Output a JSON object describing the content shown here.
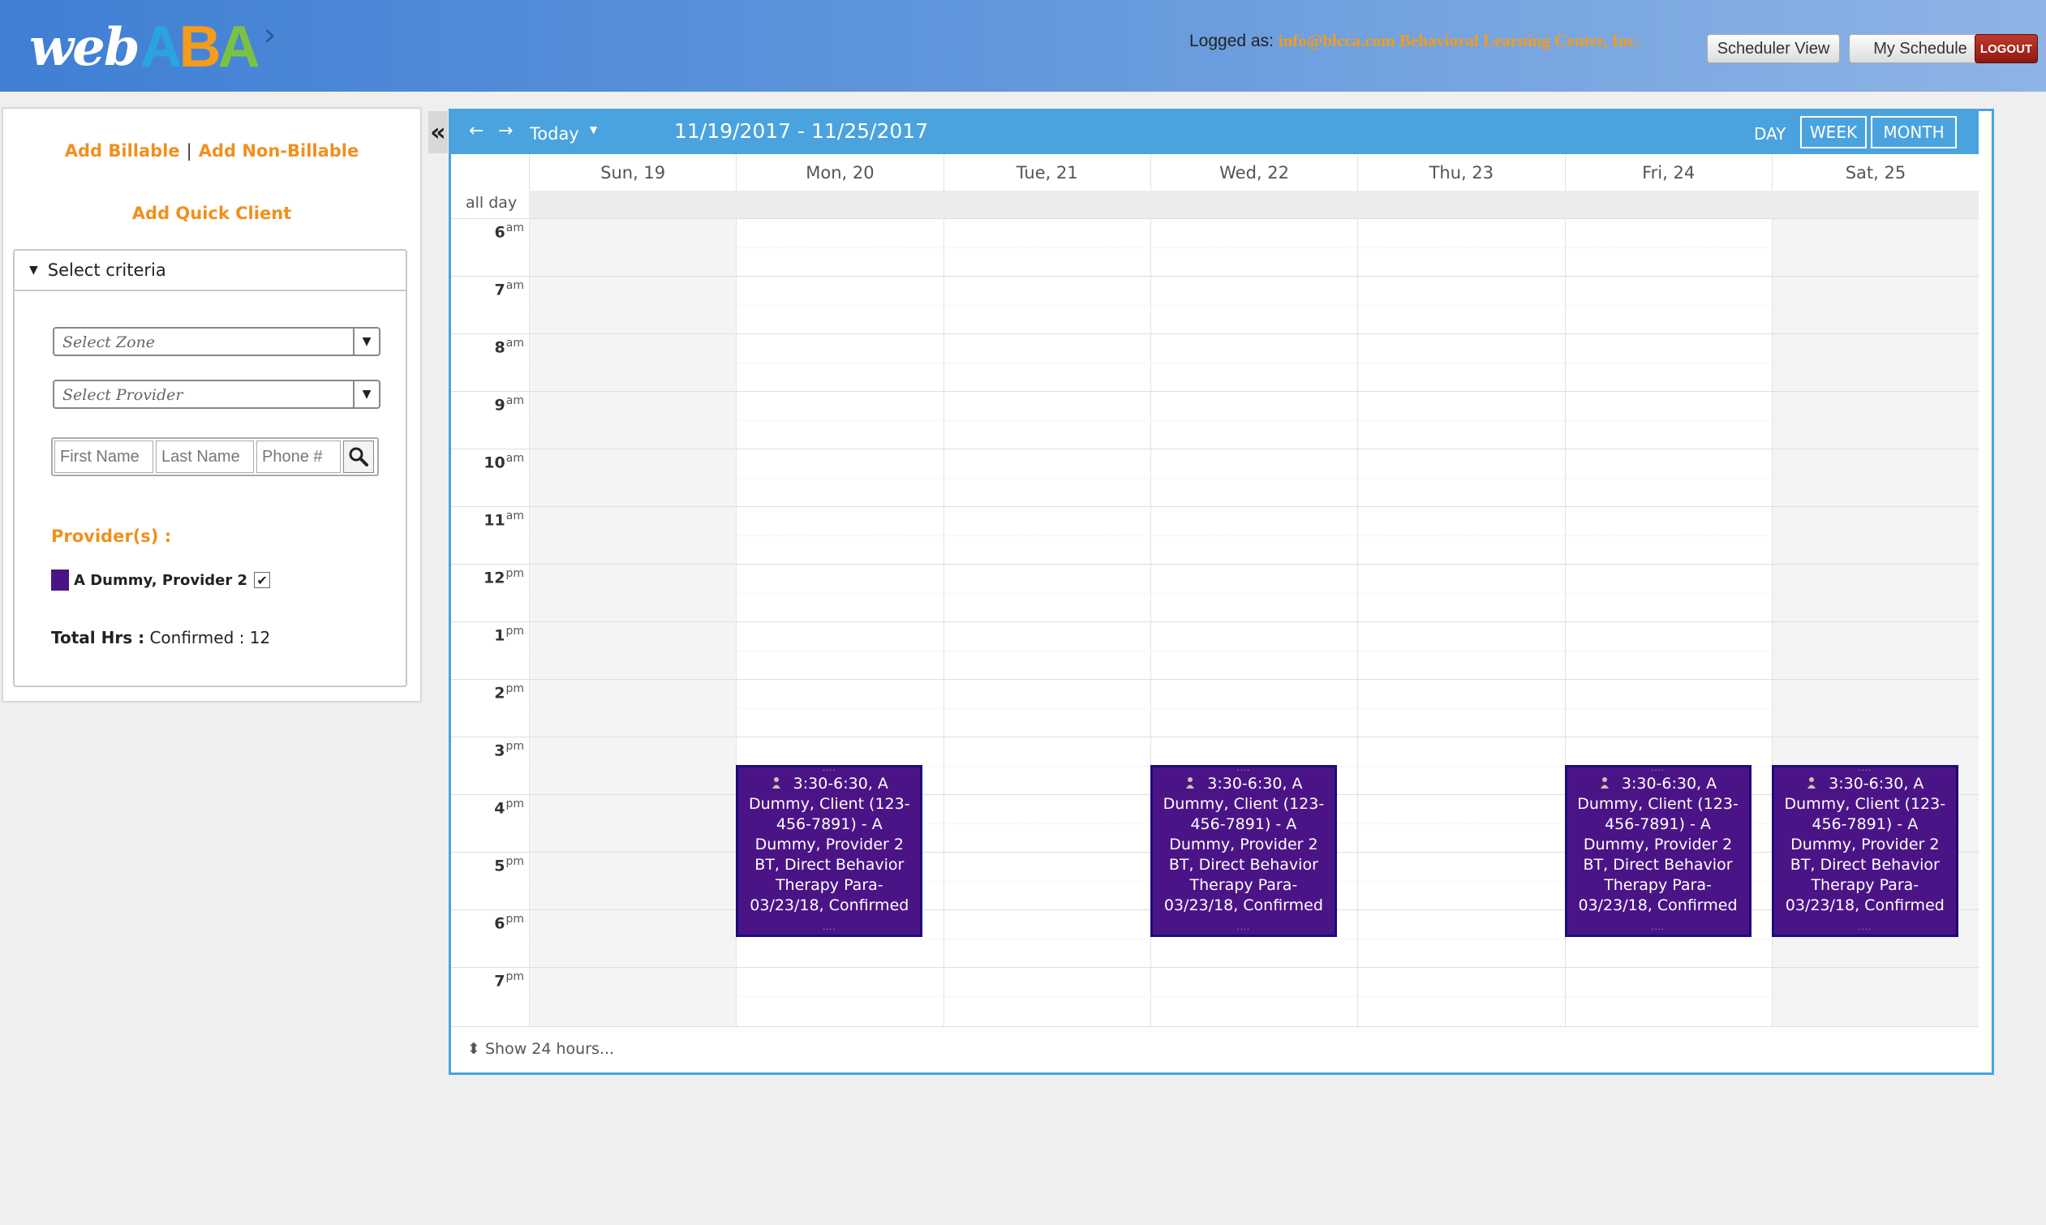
{
  "header": {
    "logo": {
      "web": "web",
      "aba": "ABA"
    },
    "logged_as_label": "Logged as:",
    "logged_as_value": "info@blcca.com Behavioral Learning Center, Inc.",
    "buttons": {
      "scheduler_view": "Scheduler View",
      "my_schedule": "My Schedule",
      "logout": "LOGOUT"
    }
  },
  "sidebar": {
    "add_billable": "Add Billable",
    "separator": "|",
    "add_non_billable": "Add Non-Billable",
    "add_quick_client": "Add Quick Client",
    "criteria_title": "Select criteria",
    "select_zone_placeholder": "Select Zone",
    "select_provider_placeholder": "Select Provider",
    "first_name_placeholder": "First Name",
    "last_name_placeholder": "Last Name",
    "phone_placeholder": "Phone #",
    "providers_label": "Provider(s) :",
    "provider_name": "A Dummy, Provider 2",
    "provider_color": "#4a1487",
    "provider_checked": true,
    "total_hrs_label": "Total Hrs :",
    "total_hrs_value": "Confirmed : 12"
  },
  "calendar": {
    "collapse_icon": "«",
    "toolbar": {
      "prev_icon": "←",
      "next_icon": "→",
      "today": "Today",
      "today_dropdown_icon": "▼",
      "range": "11/19/2017 - 11/25/2017",
      "views": {
        "day": "DAY",
        "week": "WEEK",
        "month": "MONTH"
      }
    },
    "days": [
      "Sun, 19",
      "Mon, 20",
      "Tue, 21",
      "Wed, 22",
      "Thu, 23",
      "Fri, 24",
      "Sat, 25"
    ],
    "all_day_label": "all day",
    "hours": [
      {
        "h": "6",
        "ap": "am"
      },
      {
        "h": "7",
        "ap": "am"
      },
      {
        "h": "8",
        "ap": "am"
      },
      {
        "h": "9",
        "ap": "am"
      },
      {
        "h": "10",
        "ap": "am"
      },
      {
        "h": "11",
        "ap": "am"
      },
      {
        "h": "12",
        "ap": "pm"
      },
      {
        "h": "1",
        "ap": "pm"
      },
      {
        "h": "2",
        "ap": "pm"
      },
      {
        "h": "3",
        "ap": "pm"
      },
      {
        "h": "4",
        "ap": "pm"
      },
      {
        "h": "5",
        "ap": "pm"
      },
      {
        "h": "6",
        "ap": "pm"
      },
      {
        "h": "7",
        "ap": "pm"
      }
    ],
    "event_color": "#4a1487",
    "events": [
      {
        "day": "Mon, 20",
        "text": "3:30-6:30, A Dummy, Client (123-456-7891) - A Dummy, Provider 2 BT, Direct Behavior Therapy Para-03/23/18, Confirmed"
      },
      {
        "day": "Wed, 22",
        "text": "3:30-6:30, A Dummy, Client (123-456-7891) - A Dummy, Provider 2 BT, Direct Behavior Therapy Para-03/23/18, Confirmed"
      },
      {
        "day": "Fri, 24",
        "text": "3:30-6:30, A Dummy, Client (123-456-7891) - A Dummy, Provider 2 BT, Direct Behavior Therapy Para-03/23/18, Confirmed"
      },
      {
        "day": "Sat, 25",
        "text": "3:30-6:30, A Dummy, Client (123-456-7891) - A Dummy, Provider 2 BT, Direct Behavior Therapy Para-03/23/18, Confirmed"
      }
    ],
    "footer": {
      "expand_icon": "⬍",
      "show_24": "Show 24 hours..."
    }
  }
}
